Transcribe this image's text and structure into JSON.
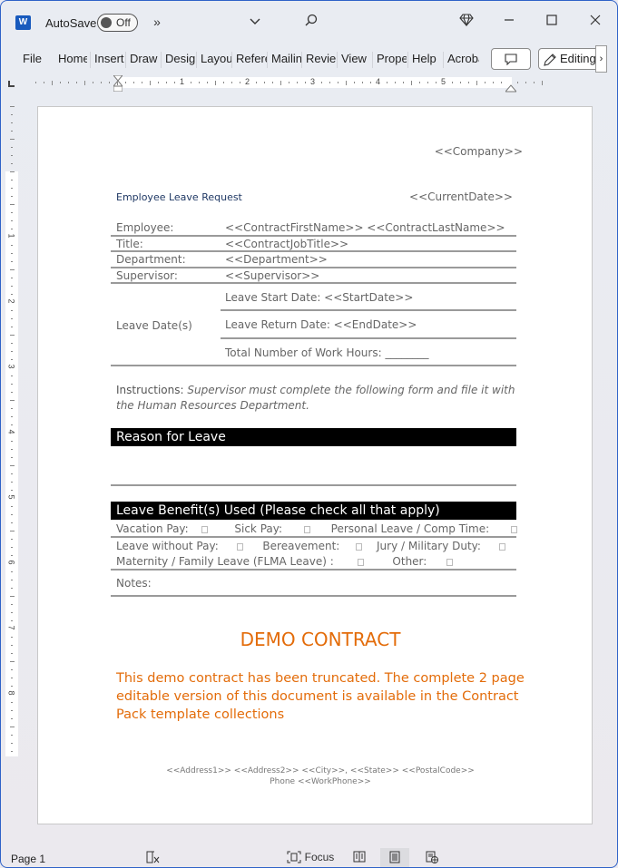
{
  "titlebar": {
    "app_icon": "word-logo",
    "app_letter": "W",
    "autosave_label": "AutoSave",
    "autosave_state": "Off",
    "overflow_icon": "»",
    "customize_icon": "chevron-down-icon",
    "search_icon": "search-icon",
    "premium_icon": "diamond-icon",
    "minimize_icon": "minimize-icon",
    "maximize_icon": "maximize-icon",
    "close_icon": "close-icon"
  },
  "ribbon": {
    "tabs": [
      {
        "label": "File"
      },
      {
        "label": "Home"
      },
      {
        "label": "Insert"
      },
      {
        "label": "Draw"
      },
      {
        "label": "Design"
      },
      {
        "label": "Layout"
      },
      {
        "label": "References"
      },
      {
        "label": "Mailings"
      },
      {
        "label": "Review"
      },
      {
        "label": "View"
      },
      {
        "label": "Properties"
      },
      {
        "label": "Help"
      },
      {
        "label": "Acrobat"
      }
    ],
    "comments_button_icon": "comment-icon",
    "editing_label": "Editing",
    "editing_icon": "pencil-icon",
    "expand_icon": "›"
  },
  "ruler": {
    "horizontal_numbers": [
      "1",
      "2",
      "3",
      "4",
      "5"
    ],
    "vertical_numbers": [
      "1",
      "2",
      "3",
      "4",
      "5",
      "6",
      "7",
      "8"
    ]
  },
  "document": {
    "company": "<<Company>>",
    "title": "Employee Leave Request",
    "current_date": "<<CurrentDate>>",
    "info_rows": [
      {
        "label": "Employee:",
        "value": "<<ContractFirstName>> <<ContractLastName>>"
      },
      {
        "label": "Title:",
        "value": "<<ContractJobTitle>>"
      },
      {
        "label": "Department:",
        "value": "<<Department>>"
      },
      {
        "label": "Supervisor:",
        "value": "<<Supervisor>>"
      }
    ],
    "leave_dates": {
      "label": "Leave Date(s)",
      "start": "Leave Start Date: <<StartDate>>",
      "return": "Leave Return Date: <<EndDate>>",
      "hours": "Total Number of Work Hours: ________"
    },
    "instructions_label": "Instructions:",
    "instructions_text": "Supervisor must complete the following form and file it with the Human Resources Department.",
    "reason_header": "Reason for Leave",
    "benefits_header": "Leave Benefit(s) Used (Please check all that apply)",
    "benefits": [
      {
        "label": "Vacation Pay:",
        "checked": false
      },
      {
        "label": "Sick Pay:",
        "checked": false
      },
      {
        "label": "Personal Leave / Comp Time:",
        "checked": false
      },
      {
        "label": "Leave without Pay:",
        "checked": false
      },
      {
        "label": "Bereavement:",
        "checked": false
      },
      {
        "label": "Jury / Military Duty:",
        "checked": false
      },
      {
        "label": "Maternity / Family Leave (FLMA Leave)  :",
        "checked": false
      },
      {
        "label": "Other:",
        "checked": false
      }
    ],
    "notes_label": "Notes:",
    "demo_title": "DEMO CONTRACT",
    "demo_body": "This demo contract has been truncated. The complete 2 page editable version of this document is available in the Contract Pack template collections",
    "footer_line1": "<<Address1>> <<Address2>> <<City>>, <<State>> <<PostalCode>>",
    "footer_line2": "Phone <<WorkPhone>>"
  },
  "statusbar": {
    "page": "Page 1",
    "focus_label": "Focus",
    "views": [
      "read-mode-icon",
      "print-layout-icon",
      "web-layout-icon"
    ],
    "active_view": "print-layout-icon"
  },
  "colors": {
    "accent_blue": "#185abd",
    "demo_orange": "#e36c0a",
    "title_navy": "#1f3864",
    "header_bar": "#000000"
  }
}
